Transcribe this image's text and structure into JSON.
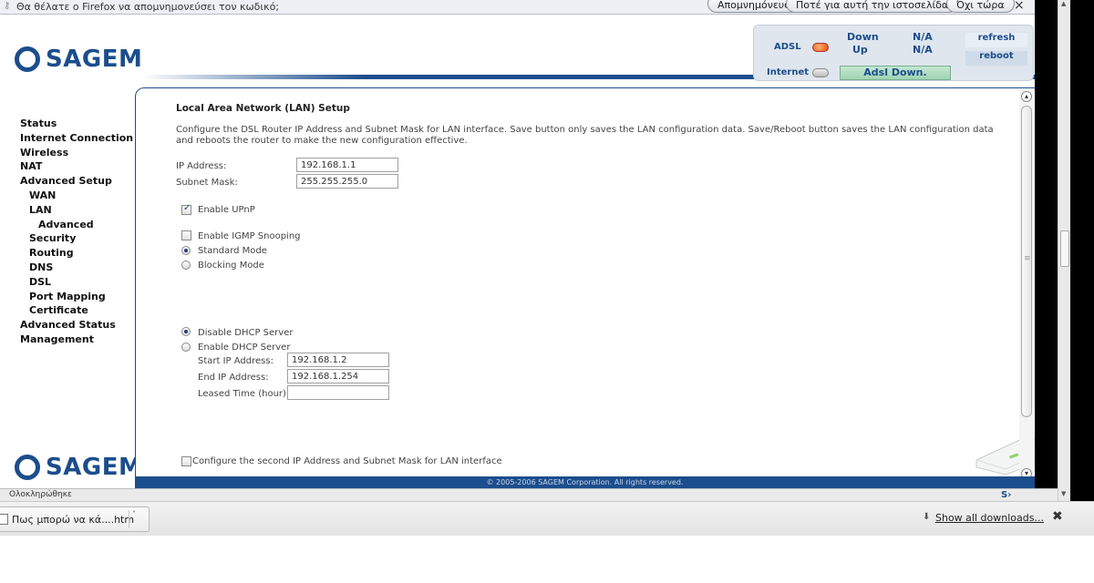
{
  "notification": {
    "message": "Θα θέλατε ο Firefox να απομνημονεύσει τον κωδικό;",
    "buttons": [
      "Απομνημόνευση",
      "Ποτέ για αυτή την ιστοσελίδα",
      "Όχι τώρα"
    ],
    "close": "×"
  },
  "brand": {
    "logo_text": "SAGEM"
  },
  "status_panel": {
    "adsl_label": "ADSL",
    "down_label": "Down",
    "up_label": "Up",
    "down_value": "N/A",
    "up_value": "N/A",
    "internet_label": "Internet",
    "adsl_status": "Adsl Down.",
    "refresh": "refresh",
    "reboot": "reboot"
  },
  "nav": {
    "items": [
      {
        "label": "Status",
        "level": 0
      },
      {
        "label": "Internet Connection",
        "level": 0
      },
      {
        "label": "Wireless",
        "level": 0
      },
      {
        "label": "NAT",
        "level": 0
      },
      {
        "label": "Advanced Setup",
        "level": 0
      },
      {
        "label": "WAN",
        "level": 1
      },
      {
        "label": "LAN",
        "level": 1
      },
      {
        "label": "Advanced",
        "level": 2
      },
      {
        "label": "Security",
        "level": 1
      },
      {
        "label": "Routing",
        "level": 1
      },
      {
        "label": "DNS",
        "level": 1
      },
      {
        "label": "DSL",
        "level": 1
      },
      {
        "label": "Port Mapping",
        "level": 1
      },
      {
        "label": "Certificate",
        "level": 1
      },
      {
        "label": "Advanced Status",
        "level": 0
      },
      {
        "label": "Management",
        "level": 0
      }
    ]
  },
  "lan": {
    "title": "Local Area Network (LAN) Setup",
    "description": "Configure the DSL Router IP Address and Subnet Mask for LAN interface.  Save button only saves the LAN configuration data.  Save/Reboot button saves the LAN configuration data and reboots the router to make the new configuration effective.",
    "ip_label": "IP Address:",
    "ip_value": "192.168.1.1",
    "mask_label": "Subnet Mask:",
    "mask_value": "255.255.255.0",
    "upnp_label": "Enable UPnP",
    "upnp_checked": true,
    "igmp_label": "Enable IGMP Snooping",
    "igmp_checked": false,
    "standard_mode": "Standard Mode",
    "blocking_mode": "Blocking Mode",
    "mode_selected": "Standard Mode",
    "dhcp_disable": "Disable DHCP Server",
    "dhcp_enable": "Enable DHCP Server",
    "dhcp_selected": "Disable DHCP Server",
    "start_ip_label": "Start IP Address:",
    "start_ip_value": "192.168.1.2",
    "end_ip_label": "End IP Address:",
    "end_ip_value": "192.168.1.254",
    "lease_label": "Leased Time (hour):",
    "lease_value": "",
    "second_ip_label": "Configure the second IP Address and Subnet Mask for LAN interface"
  },
  "footer": {
    "copyright": "© 2005-2006 SAGEM Corporation. All rights reserved."
  },
  "statusbar": {
    "text": "Ολοκληρώθηκε"
  },
  "downloads": {
    "item_name": "Πως μπορώ να κά....htm",
    "show_all": "Show all downloads...",
    "close": "✖"
  }
}
